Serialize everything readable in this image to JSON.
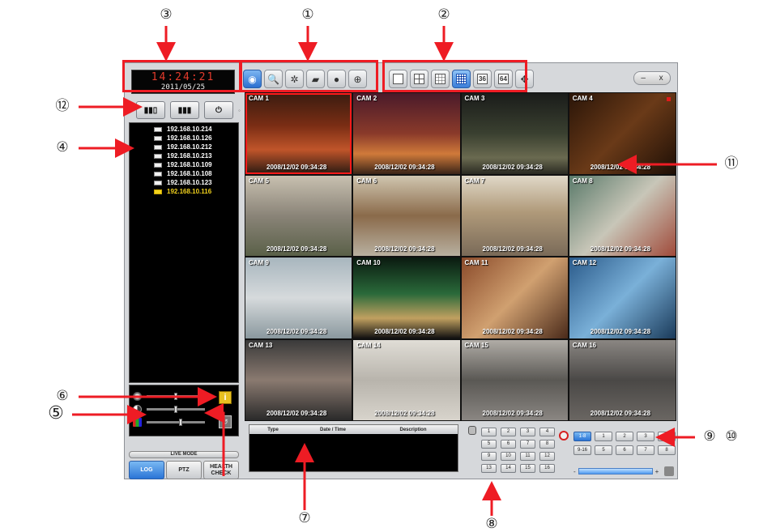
{
  "clock": {
    "time": "14:24:21",
    "date": "2011/05/25"
  },
  "toolbar": {
    "main": [
      {
        "icon": "eye-icon",
        "glyph": "◉",
        "active": true
      },
      {
        "icon": "search-icon",
        "glyph": "🔍"
      },
      {
        "icon": "settings-icon",
        "glyph": "✲"
      },
      {
        "icon": "camera-icon",
        "glyph": "▰"
      },
      {
        "icon": "disc-icon",
        "glyph": "●"
      },
      {
        "icon": "globe-icon",
        "glyph": "⊕"
      }
    ],
    "views": [
      {
        "icon": "layout-1-icon"
      },
      {
        "icon": "layout-4-icon"
      },
      {
        "icon": "layout-9-icon"
      },
      {
        "icon": "layout-16-icon",
        "selected": true
      },
      {
        "icon": "layout-36-icon",
        "label": "36"
      },
      {
        "icon": "layout-64-icon",
        "label": "64"
      },
      {
        "icon": "fullscreen-icon",
        "glyph": "✥"
      }
    ],
    "window_controls": {
      "minimize": "–",
      "close": "x"
    }
  },
  "controls": [
    "▮▮▯",
    "▮▮▮",
    "⏻"
  ],
  "device_tree": [
    {
      "ip": "192.168.10.214"
    },
    {
      "ip": "192.168.10.126"
    },
    {
      "ip": "192.168.10.212"
    },
    {
      "ip": "192.168.10.213"
    },
    {
      "ip": "192.168.10.109"
    },
    {
      "ip": "192.168.10.108"
    },
    {
      "ip": "192.168.10.123"
    },
    {
      "ip": "192.168.10.116",
      "selected": true
    }
  ],
  "adjust": {
    "info_button": "i",
    "reset_button": "↺"
  },
  "live_mode": {
    "title": "LIVE MODE",
    "tabs": [
      "LOG",
      "PTZ",
      "HEALTH CHECK"
    ],
    "active": "LOG"
  },
  "cameras": [
    {
      "name": "CAM 1",
      "ts": "2008/12/02  09:34:28"
    },
    {
      "name": "CAM 2",
      "ts": "2008/12/02  09:34:28"
    },
    {
      "name": "CAM 3",
      "ts": "2008/12/02  09:34:28"
    },
    {
      "name": "CAM 4",
      "ts": "2008/12/02  09:34:28"
    },
    {
      "name": "CAM 5",
      "ts": "2008/12/02  09:34:28"
    },
    {
      "name": "CAM 6",
      "ts": "2008/12/02  09:34:28"
    },
    {
      "name": "CAM 7",
      "ts": "2008/12/02  09:34:28"
    },
    {
      "name": "CAM 8",
      "ts": "2008/12/02  09:34:28"
    },
    {
      "name": "CAM 9",
      "ts": "2008/12/02  09:34:28"
    },
    {
      "name": "CAM 10",
      "ts": "2008/12/02  09:34:28"
    },
    {
      "name": "CAM 11",
      "ts": "2008/12/02  09:34:28"
    },
    {
      "name": "CAM 12",
      "ts": "2008/12/02  09:34:28"
    },
    {
      "name": "CAM 13",
      "ts": "2008/12/02  09:34:28"
    },
    {
      "name": "CAM 14",
      "ts": "2008/12/02  09:34:28"
    },
    {
      "name": "CAM 15",
      "ts": "2008/12/02  09:34:28"
    },
    {
      "name": "CAM 16",
      "ts": "2008/12/02  09:34:28"
    }
  ],
  "log": {
    "headers": [
      "Type",
      "Date / Time",
      "Description"
    ]
  },
  "channels": [
    "1",
    "2",
    "3",
    "4",
    "5",
    "6",
    "7",
    "8",
    "9",
    "10",
    "11",
    "12",
    "13",
    "14",
    "15",
    "16"
  ],
  "playback": [
    "1-8",
    "1",
    "2",
    "3",
    "4",
    "9-16",
    "5",
    "6",
    "7",
    "8"
  ],
  "volume": {
    "minus": "-",
    "plus": "+",
    "level": 0.9
  },
  "callouts": [
    "①",
    "②",
    "③",
    "④",
    "⑤",
    "⑥",
    "⑦",
    "⑧",
    "⑨",
    "⑩",
    "⑪",
    "⑫"
  ]
}
